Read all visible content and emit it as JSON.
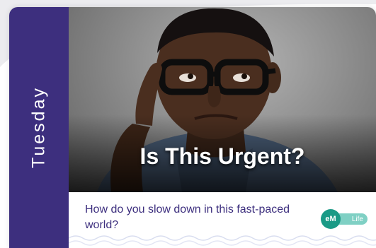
{
  "day": {
    "label": "Tuesday"
  },
  "headline": {
    "text": "Is This Urgent?"
  },
  "caption": {
    "text": "How do you slow down in this fast-paced world?"
  },
  "logo": {
    "mark": "eM",
    "word": "Life"
  },
  "colors": {
    "purple": "#3d2f7e",
    "teal": "#1a9a86",
    "teal_light": "#7fd0c4",
    "background_gray": "#ececef"
  },
  "icons": {
    "photo": "thinking-man-photo",
    "logo": "emlife-logo-icon"
  }
}
